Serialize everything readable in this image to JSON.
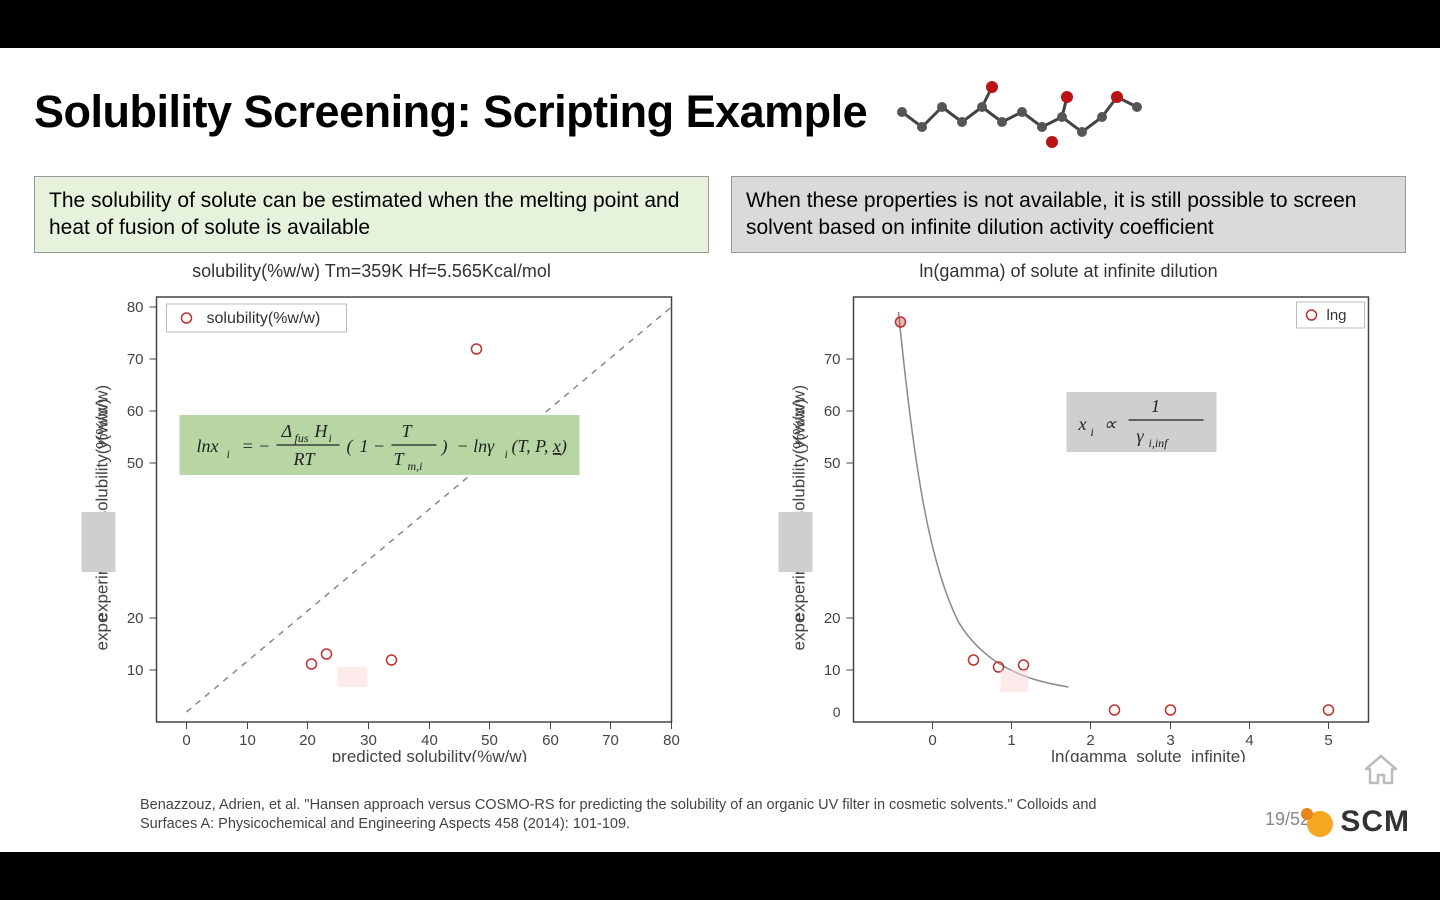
{
  "title": "Solubility Screening: Scripting Example",
  "left_callout": "The solubility of solute can be estimated when the melting point and heat of fusion of solute is available",
  "right_callout": "When these properties is not available, it is still possible to screen solvent based on infinite dilution activity coefficient",
  "citation": "Benazzouz, Adrien, et al. \"Hansen approach versus COSMO-RS for predicting the solubility of an organic UV filter in cosmetic solvents.\" Colloids and Surfaces A: Physicochemical and Engineering Aspects 458 (2014): 101-109.",
  "page": "19/52",
  "logo_text": "SCM",
  "left_chart": {
    "title": "solubility(%w/w) Tm=359K Hf=5.565Kcal/mol",
    "xlabel": "predicted solubility(%w/w)",
    "ylabel": "experimental solubility(%w/w)",
    "legend": "solubility(%w/w)",
    "equation_label": "ln x_i = − Δ_fus H_i / RT · (1 − T / T_m,i) − ln γ_i(T, P, x)"
  },
  "right_chart": {
    "title": "ln(gamma) of solute at infinite dilution",
    "xlabel": "ln(gamma_solute_infinite)",
    "ylabel": "experimental solubility(%w/w)",
    "legend": "lng",
    "equation_label": "x_i ∝ 1 / γ_i,inf"
  },
  "chart_data": [
    {
      "type": "scatter",
      "name": "left",
      "xlabel": "predicted solubility(%w/w)",
      "ylabel": "experimental solubility(%w/w)",
      "xlim": [
        -5,
        80
      ],
      "ylim": [
        -2,
        80
      ],
      "xticks": [
        0,
        10,
        20,
        30,
        40,
        50,
        60,
        70,
        80
      ],
      "yticks": [
        10,
        20,
        50,
        60,
        70,
        80
      ],
      "series": [
        {
          "name": "solubility(%w/w)",
          "points": [
            {
              "x": 21,
              "y": 11
            },
            {
              "x": 23,
              "y": 13
            },
            {
              "x": 34,
              "y": 12
            },
            {
              "x": 48,
              "y": 72
            }
          ]
        }
      ],
      "reference_line": "y = x (dashed)"
    },
    {
      "type": "scatter",
      "name": "right",
      "xlabel": "ln(gamma_solute_infinite)",
      "ylabel": "experimental solubility(%w/w)",
      "xlim": [
        -1,
        5.5
      ],
      "ylim": [
        -2,
        80
      ],
      "xticks": [
        0,
        1,
        2,
        3,
        4,
        5
      ],
      "yticks": [
        10,
        20,
        50,
        60,
        70
      ],
      "series": [
        {
          "name": "lng",
          "points": [
            {
              "x": -0.4,
              "y": 72
            },
            {
              "x": 0.5,
              "y": 12
            },
            {
              "x": 0.8,
              "y": 11
            },
            {
              "x": 1.1,
              "y": 11
            },
            {
              "x": 2.3,
              "y": 1
            },
            {
              "x": 3.0,
              "y": 1
            },
            {
              "x": 5.0,
              "y": 1
            }
          ]
        }
      ],
      "trend_curve": "monotone decreasing (gray)"
    }
  ]
}
